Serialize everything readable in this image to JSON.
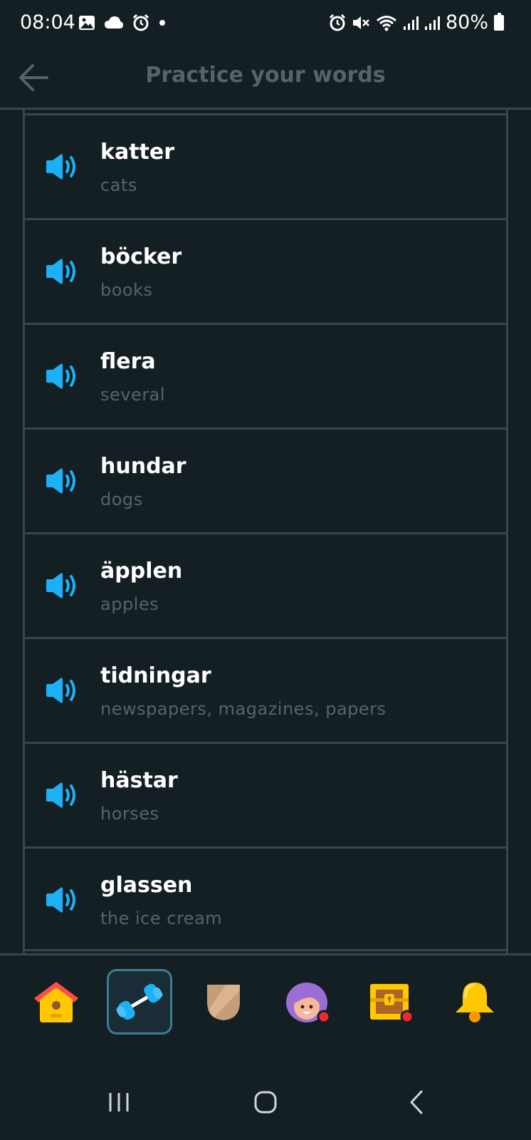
{
  "status_bar": {
    "time": "08:04",
    "battery": "80%"
  },
  "header": {
    "title": "Practice your words"
  },
  "words": [
    {
      "word": "katter",
      "translation": "cats"
    },
    {
      "word": "böcker",
      "translation": "books"
    },
    {
      "word": "flera",
      "translation": "several"
    },
    {
      "word": "hundar",
      "translation": "dogs"
    },
    {
      "word": "äpplen",
      "translation": "apples"
    },
    {
      "word": "tidningar",
      "translation": "newspapers, magazines, papers"
    },
    {
      "word": "hästar",
      "translation": "horses"
    },
    {
      "word": "glassen",
      "translation": "the ice cream"
    }
  ],
  "bottom_nav": {
    "items": [
      {
        "icon": "home-icon"
      },
      {
        "icon": "dumbbell-icon",
        "active": true
      },
      {
        "icon": "shield-icon"
      },
      {
        "icon": "profile-avatar-icon"
      },
      {
        "icon": "treasure-chest-icon"
      },
      {
        "icon": "bell-icon"
      }
    ]
  },
  "colors": {
    "background": "#141f24",
    "border": "#37464f",
    "muted_text": "#52656d",
    "speaker": "#1cb0f6",
    "active_nav_border": "#3c7c95"
  }
}
